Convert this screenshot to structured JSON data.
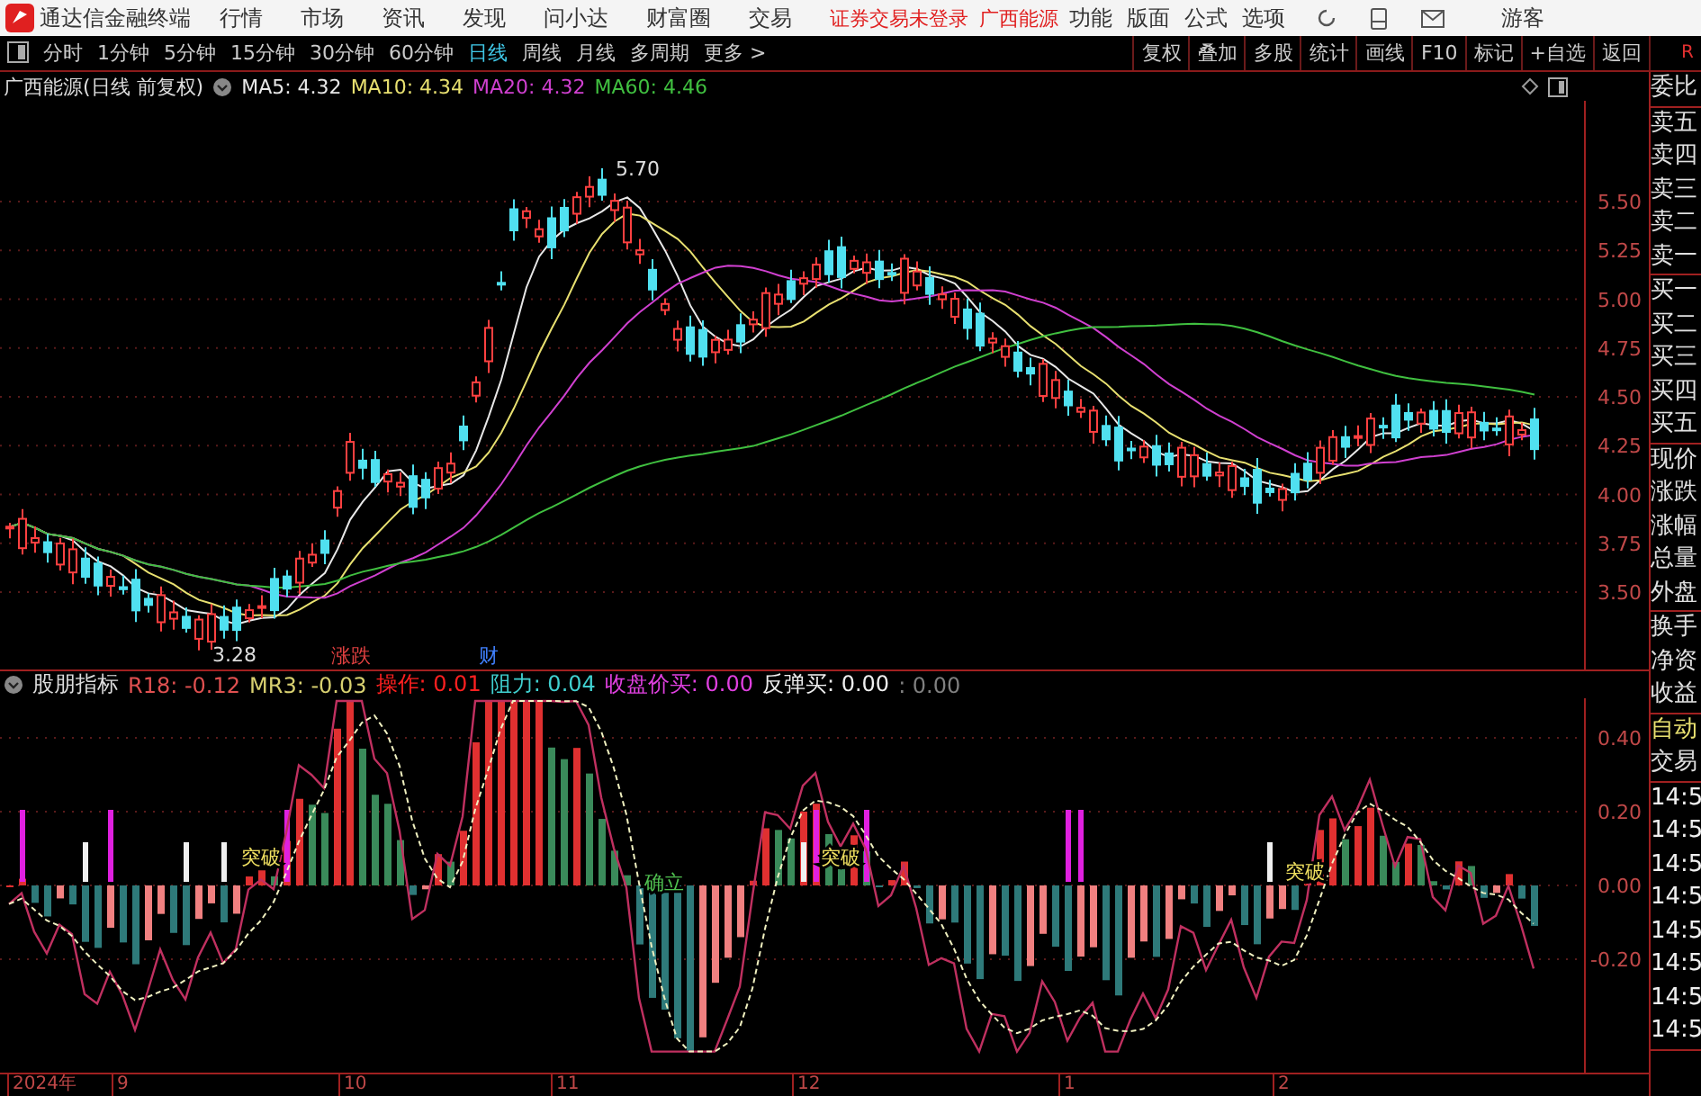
{
  "app": {
    "title": "通达信金融终端"
  },
  "menu": [
    "行情",
    "市场",
    "资讯",
    "发现",
    "问小达",
    "财富圈",
    "交易"
  ],
  "notice": "证券交易未登录",
  "stock_link": "广西能源",
  "menu_right": [
    "功能",
    "版面",
    "公式",
    "选项"
  ],
  "user": "游客",
  "periods": [
    {
      "label": "分时",
      "selected": false
    },
    {
      "label": "1分钟",
      "selected": false
    },
    {
      "label": "5分钟",
      "selected": false
    },
    {
      "label": "15分钟",
      "selected": false
    },
    {
      "label": "30分钟",
      "selected": false
    },
    {
      "label": "60分钟",
      "selected": false
    },
    {
      "label": "日线",
      "selected": true
    },
    {
      "label": "周线",
      "selected": false
    },
    {
      "label": "月线",
      "selected": false
    },
    {
      "label": "多周期",
      "selected": false
    },
    {
      "label": "更多 >",
      "selected": false
    }
  ],
  "tools": [
    "复权",
    "叠加",
    "多股",
    "统计",
    "画线",
    "F10",
    "标记",
    "+自选",
    "返回"
  ],
  "corner": "R",
  "chart": {
    "title": "广西能源(日线 前复权)",
    "ma": [
      {
        "label": "MA5: 4.32",
        "color": "#e8e8e8"
      },
      {
        "label": "MA10: 4.34",
        "color": "#e8e070"
      },
      {
        "label": "MA20: 4.32",
        "color": "#d040d0"
      },
      {
        "label": "MA60: 4.46",
        "color": "#40c040"
      }
    ],
    "high_label": "5.70",
    "low_label": "3.28",
    "events": [
      "涨跌",
      "财"
    ],
    "yticks": [
      "5.50",
      "5.25",
      "5.00",
      "4.75",
      "4.50",
      "4.25",
      "4.00",
      "3.75",
      "3.50"
    ]
  },
  "indicator": {
    "name": "股朋指标",
    "values": [
      {
        "label": "R18: -0.12",
        "color": "#e05050"
      },
      {
        "label": "MR3: -0.03",
        "color": "#d8d070"
      },
      {
        "label": "操作: 0.01",
        "color": "#ff2020"
      },
      {
        "label": "阻力: 0.04",
        "color": "#40d0d0"
      },
      {
        "label": "收盘价买: 0.00",
        "color": "#e040e0"
      },
      {
        "label": "反弹买: 0.00",
        "color": "#f0f0f0"
      },
      {
        "label": ": 0.00",
        "color": "#808080"
      }
    ],
    "signals": [
      {
        "label": "突破",
        "kind": "breakout"
      },
      {
        "label": "确立",
        "kind": "confirm"
      },
      {
        "label": "突破",
        "kind": "breakout"
      },
      {
        "label": "突破",
        "kind": "breakout"
      }
    ],
    "yticks": [
      "0.40",
      "0.20",
      "0.00",
      "-0.20"
    ]
  },
  "dates": [
    "2024年",
    "9",
    "10",
    "11",
    "12",
    "1",
    "2"
  ],
  "side": {
    "groups": [
      [
        {
          "label": "委比",
          "kind": "field"
        }
      ],
      [
        {
          "label": "卖五",
          "kind": "field"
        },
        {
          "label": "卖四",
          "kind": "field"
        },
        {
          "label": "卖三",
          "kind": "field"
        },
        {
          "label": "卖二",
          "kind": "field"
        },
        {
          "label": "卖一",
          "kind": "field"
        }
      ],
      [
        {
          "label": "买一",
          "kind": "field"
        },
        {
          "label": "买二",
          "kind": "field"
        },
        {
          "label": "买三",
          "kind": "field"
        },
        {
          "label": "买四",
          "kind": "field"
        },
        {
          "label": "买五",
          "kind": "field"
        }
      ],
      [
        {
          "label": "现价",
          "kind": "field"
        },
        {
          "label": "涨跌",
          "kind": "field"
        },
        {
          "label": "涨幅",
          "kind": "field"
        },
        {
          "label": "总量",
          "kind": "field"
        },
        {
          "label": "外盘",
          "kind": "field"
        }
      ],
      [
        {
          "label": "换手",
          "kind": "field"
        },
        {
          "label": "净资",
          "kind": "field"
        },
        {
          "label": "收益",
          "kind": "field"
        }
      ],
      [
        {
          "label": "自动",
          "kind": "mode"
        },
        {
          "label": "交易",
          "kind": "field"
        }
      ],
      [
        {
          "label": "14:5",
          "kind": "time"
        },
        {
          "label": "14:5",
          "kind": "time"
        },
        {
          "label": "14:5",
          "kind": "time"
        },
        {
          "label": "14:5",
          "kind": "time"
        },
        {
          "label": "14:5",
          "kind": "time"
        },
        {
          "label": "14:5",
          "kind": "time"
        },
        {
          "label": "14:5",
          "kind": "time"
        },
        {
          "label": "14:5",
          "kind": "time"
        }
      ]
    ]
  }
}
